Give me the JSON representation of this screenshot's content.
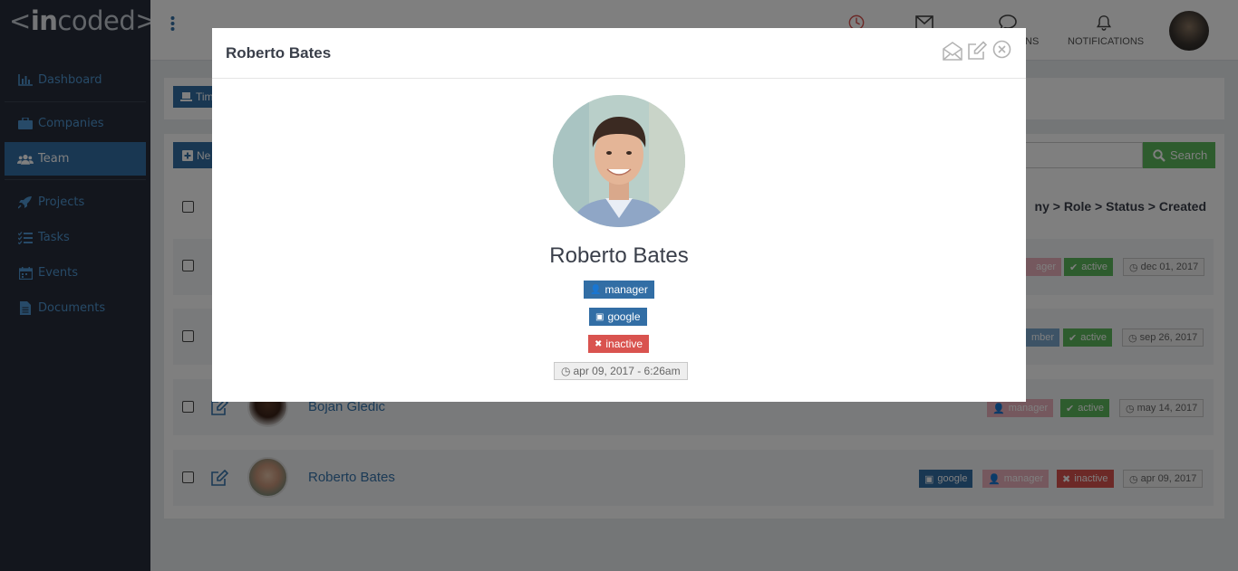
{
  "app": {
    "logo_left": "<",
    "logo_bold": "in",
    "logo_right": "coded>"
  },
  "sidebar": {
    "items": [
      {
        "label": "Dashboard",
        "icon": "bar-chart-icon"
      },
      {
        "label": "Companies",
        "icon": "briefcase-icon"
      },
      {
        "label": "Team",
        "icon": "users-icon",
        "active": true
      },
      {
        "label": "Projects",
        "icon": "rocket-icon"
      },
      {
        "label": "Tasks",
        "icon": "tasks-icon"
      },
      {
        "label": "Events",
        "icon": "calendar-icon"
      },
      {
        "label": "Documents",
        "icon": "document-icon"
      }
    ]
  },
  "topbar": {
    "partial_label": "NS",
    "notifications_label": "NOTIFICATIONS",
    "icons": [
      "clock-icon",
      "envelope-icon",
      "chat-icon",
      "bell-icon"
    ]
  },
  "toolbar": {
    "time_button_partial": "Tim",
    "new_button_partial": "Ne",
    "search_button": "Search"
  },
  "table": {
    "header_partial": "ny > Role > Status > Created",
    "rows": [
      {
        "name": "",
        "badges": [
          {
            "text": "ager",
            "type": "manager"
          },
          {
            "text": "active",
            "type": "active"
          },
          {
            "text": "dec 01, 2017",
            "type": "date"
          }
        ]
      },
      {
        "name": "",
        "badges": [
          {
            "text": "mber",
            "type": "member"
          },
          {
            "text": "active",
            "type": "active"
          },
          {
            "text": "sep 26, 2017",
            "type": "date"
          }
        ]
      },
      {
        "name": "Bojan Gledic",
        "badges": [
          {
            "text": "manager",
            "type": "manager"
          },
          {
            "text": "active",
            "type": "active"
          },
          {
            "text": "may 14, 2017",
            "type": "date"
          }
        ]
      },
      {
        "name": "Roberto Bates",
        "badges": [
          {
            "text": "google",
            "type": "google"
          },
          {
            "text": "manager",
            "type": "manager"
          },
          {
            "text": "inactive",
            "type": "inactive"
          },
          {
            "text": "apr 09, 2017",
            "type": "date"
          }
        ]
      }
    ]
  },
  "modal": {
    "title": "Roberto Bates",
    "name": "Roberto Bates",
    "role": "manager",
    "company": "google",
    "status": "inactive",
    "created": "apr 09, 2017 - 6:26am"
  },
  "colors": {
    "sidebar": "#262d3a",
    "accent": "#326ea5",
    "active": "#5cb85c",
    "inactive": "#d9534f",
    "manager": "#eab1bc"
  }
}
